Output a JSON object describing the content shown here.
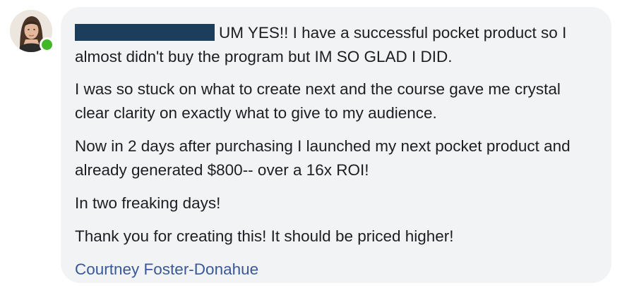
{
  "comment": {
    "redacted_name": "",
    "paragraphs": [
      "UM YES!! I have a successful pocket product so I almost didn't buy the program but IM SO GLAD I DID.",
      "I was so stuck on what to create next and the course gave me crystal clear clarity on exactly what to give to my audience.",
      "Now in 2 days after purchasing I launched my next pocket product and already generated $800-- over a 16x ROI!",
      "In two freaking days!",
      "Thank you for creating this! It should be priced higher!"
    ],
    "author": "Courtney Foster-Donahue",
    "online_status_color": "#42b72a",
    "author_link_color": "#385898",
    "redaction_color": "#1d3d5c",
    "bubble_color": "#f2f3f5"
  }
}
